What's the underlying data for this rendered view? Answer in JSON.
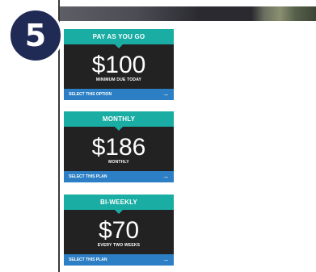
{
  "step": {
    "number": "5"
  },
  "plans": [
    {
      "title": "PAY AS YOU GO",
      "price": "$100",
      "caption": "MINIMUM DUE TODAY",
      "select_label": "SELECT THIS OPTION",
      "arrow": "→"
    },
    {
      "title": "MONTHLY",
      "price": "$186",
      "caption": "MONTHLY",
      "select_label": "SELECT THIS PLAN",
      "arrow": "→"
    },
    {
      "title": "BI-WEEKLY",
      "price": "$70",
      "caption": "EVERY TWO WEEKS",
      "select_label": "SELECT THIS PLAN",
      "arrow": "→"
    }
  ],
  "colors": {
    "header_teal": "#1aada4",
    "body_dark": "#222222",
    "select_blue": "#2c7fc4",
    "badge_navy": "#1f2a55"
  },
  "icons": {
    "select_arrow": "arrow-right-icon"
  }
}
